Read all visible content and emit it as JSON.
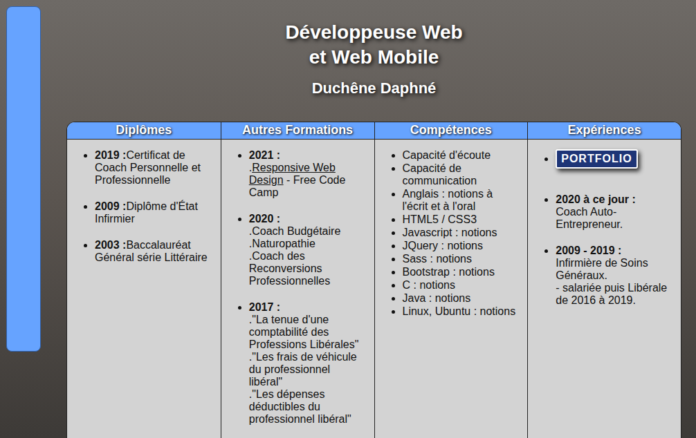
{
  "header": {
    "title_lines": [
      "Développeuse Web",
      "et Web Mobile"
    ],
    "name": "Duchêne Daphné"
  },
  "columns": [
    {
      "title": "Diplômes",
      "items": [
        {
          "kind": "inline",
          "year": "2019 :",
          "lines": [
            "Certificat de Coach Personnelle et Professionnelle"
          ]
        },
        {
          "kind": "inline",
          "year": "2009 :",
          "lines": [
            "Diplôme d'État Infirmier"
          ]
        },
        {
          "kind": "inline",
          "year": "2003 :",
          "lines": [
            "Baccalauréat Général série Littéraire"
          ]
        }
      ]
    },
    {
      "title": "Autres Formations",
      "items": [
        {
          "kind": "stacked",
          "year": "2021 :",
          "lines": [
            [
              {
                "text": ".",
                "link": false
              },
              {
                "text": "Responsive Web Design",
                "link": true
              },
              {
                "text": " - Free Code Camp",
                "link": false
              }
            ]
          ]
        },
        {
          "kind": "stacked",
          "year": "2020 :",
          "lines": [
            [
              {
                "text": ".Coach Budgétaire",
                "link": false
              }
            ],
            [
              {
                "text": ".Naturopathie",
                "link": false
              }
            ],
            [
              {
                "text": ".Coach des Reconversions Professionnelles",
                "link": false
              }
            ]
          ]
        },
        {
          "kind": "stacked",
          "year": "2017 :",
          "lines": [
            [
              {
                "text": ".\"La tenue d'une comptabilité des Professions Libérales\"",
                "link": false
              }
            ],
            [
              {
                "text": ".\"Les frais de véhicule du professionnel libéral\"",
                "link": false
              }
            ],
            [
              {
                "text": ".\"Les dépenses déductibles du professionnel libéral\"",
                "link": false
              }
            ]
          ]
        }
      ]
    },
    {
      "title": "Compétences",
      "items": [
        {
          "kind": "plain",
          "text": "Capacité d'écoute"
        },
        {
          "kind": "plain",
          "text": "Capacité de communication"
        },
        {
          "kind": "plain",
          "text": "Anglais : notions à l'écrit et à l'oral"
        },
        {
          "kind": "plain",
          "text": "HTML5 / CSS3"
        },
        {
          "kind": "plain",
          "text": "Javascript : notions"
        },
        {
          "kind": "plain",
          "text": "JQuery : notions"
        },
        {
          "kind": "plain",
          "text": "Sass : notions"
        },
        {
          "kind": "plain",
          "text": "Bootstrap : notions"
        },
        {
          "kind": "plain",
          "text": "C : notions"
        },
        {
          "kind": "plain",
          "text": "Java : notions"
        },
        {
          "kind": "plain",
          "text": "Linux, Ubuntu : notions"
        }
      ]
    },
    {
      "title": "Expériences",
      "items": [
        {
          "kind": "button",
          "text": "PORTFOLIO"
        },
        {
          "kind": "stacked",
          "year": "2020 à ce jour :",
          "lines": [
            [
              {
                "text": "Coach Auto-Entrepreneur.",
                "link": false
              }
            ]
          ]
        },
        {
          "kind": "stacked",
          "year": "2009 - 2019 :",
          "lines": [
            [
              {
                "text": "Infirmière de Soins Généraux.",
                "link": false
              }
            ],
            [
              {
                "text": "- salariée puis Libérale de 2016 à 2019.",
                "link": false
              }
            ]
          ]
        }
      ]
    }
  ]
}
